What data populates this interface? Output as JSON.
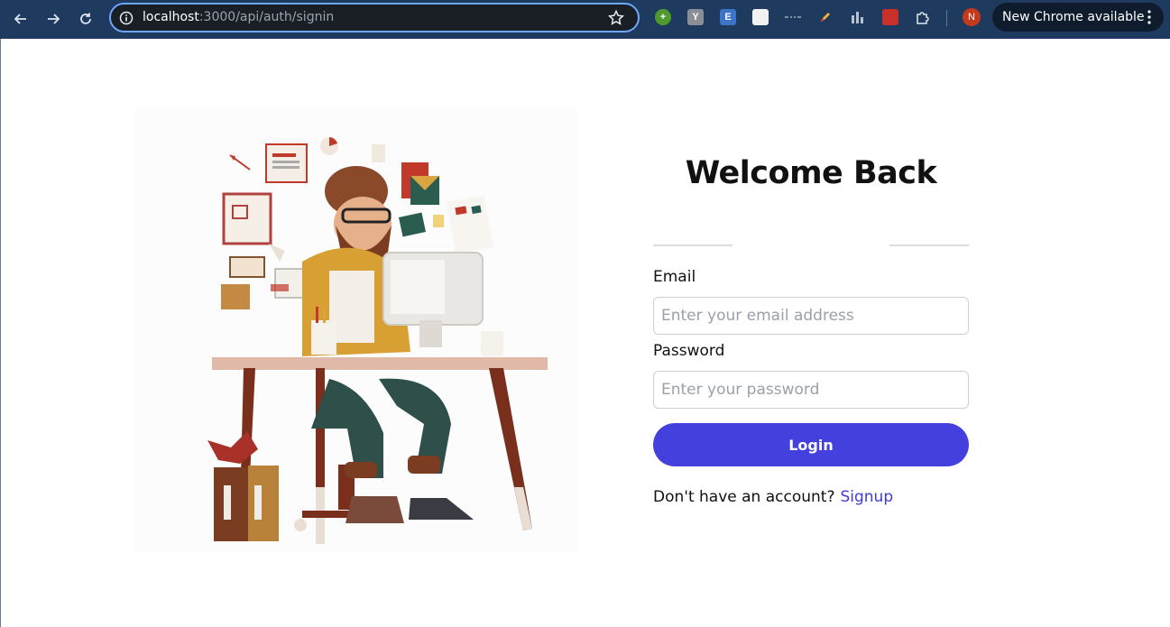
{
  "browser": {
    "url_host": "localhost",
    "url_path": ":3000/api/auth/signin",
    "update_label": "New Chrome available",
    "profile_initial": "N",
    "extensions": [
      "add-icon",
      "Y",
      "E",
      "ext-doc-icon",
      "ext-dash-icon",
      "ext-pen-icon",
      "ext-bars-icon",
      "ext-bug-icon",
      "puzzle-icon"
    ]
  },
  "login": {
    "title": "Welcome Back",
    "email_label": "Email",
    "email_placeholder": "Enter your email address",
    "password_label": "Password",
    "password_placeholder": "Enter your password",
    "login_button": "Login",
    "signup_prompt": "Don't have an account?",
    "signup_link": "Signup"
  },
  "colors": {
    "chrome": "#1f3a5f",
    "accent": "#4340dd",
    "link": "#3f3bd9"
  }
}
